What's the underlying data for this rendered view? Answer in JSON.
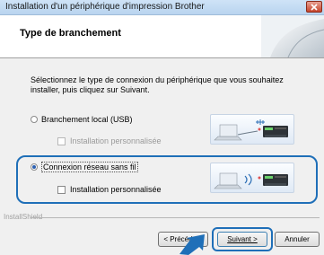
{
  "window": {
    "title": "Installation d'un périphérique d'impression Brother"
  },
  "header": {
    "title": "Type de branchement"
  },
  "description": "Sélectionnez le type de connexion du périphérique que vous souhaitez installer, puis cliquez sur Suivant.",
  "options": [
    {
      "label": "Branchement local (USB)",
      "selected": false,
      "custom_install_label": "Installation personnalisée",
      "custom_install_enabled": false,
      "illustration": "laptop-usb-printer-illustration"
    },
    {
      "label": "Connexion réseau sans fil",
      "selected": true,
      "custom_install_label": "Installation personnalisée",
      "custom_install_enabled": true,
      "illustration": "laptop-wireless-printer-illustration"
    }
  ],
  "footer": {
    "brand": "InstallShield",
    "back_label": "< Précédent",
    "next_label": "Suivant >",
    "cancel_label": "Annuler"
  },
  "colors": {
    "highlight": "#1f6fb8",
    "titlebar": "#c3dbf3",
    "close": "#c6452c"
  }
}
